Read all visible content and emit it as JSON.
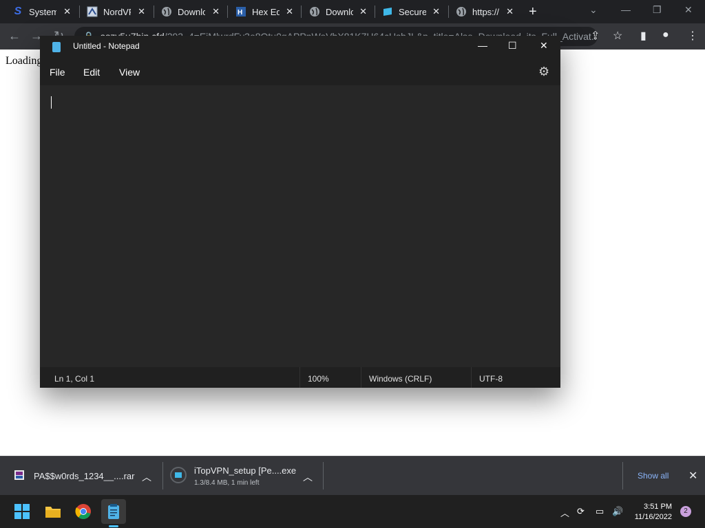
{
  "browser": {
    "tabs": [
      {
        "title": "System"
      },
      {
        "title": "NordVPN"
      },
      {
        "title": "Downloa"
      },
      {
        "title": "Hex Edit"
      },
      {
        "title": "Downloa"
      },
      {
        "title": "Secure"
      },
      {
        "title": "https://"
      }
    ],
    "address": {
      "host": "aszv5u7hin.cfd",
      "path": "/293_4=EiMlwrdFv3o8Qtu0gAPPnWoVbX81K7H64cUsbJL&p_title=Also_Download_its_Full_Activat..."
    },
    "page_text": "Loading"
  },
  "notepad": {
    "title": "Untitled - Notepad",
    "menu": [
      "File",
      "Edit",
      "View"
    ],
    "status": {
      "position": "Ln 1, Col 1",
      "zoom": "100%",
      "line_ending": "Windows (CRLF)",
      "encoding": "UTF-8"
    }
  },
  "downloads": {
    "items": [
      {
        "name": "PA$$w0rds_1234__....rar",
        "detail": ""
      },
      {
        "name": "iTopVPN_setup [Pe....exe",
        "detail": "1.3/8.4 MB, 1 min left"
      }
    ],
    "show_all": "Show all"
  },
  "taskbar": {
    "time": "3:51 PM",
    "date": "11/16/2022",
    "notifications": "2"
  },
  "colors": {
    "accent": "#8ab4f8",
    "notepad_bg": "#272727",
    "titlebar_bg": "#202020"
  }
}
